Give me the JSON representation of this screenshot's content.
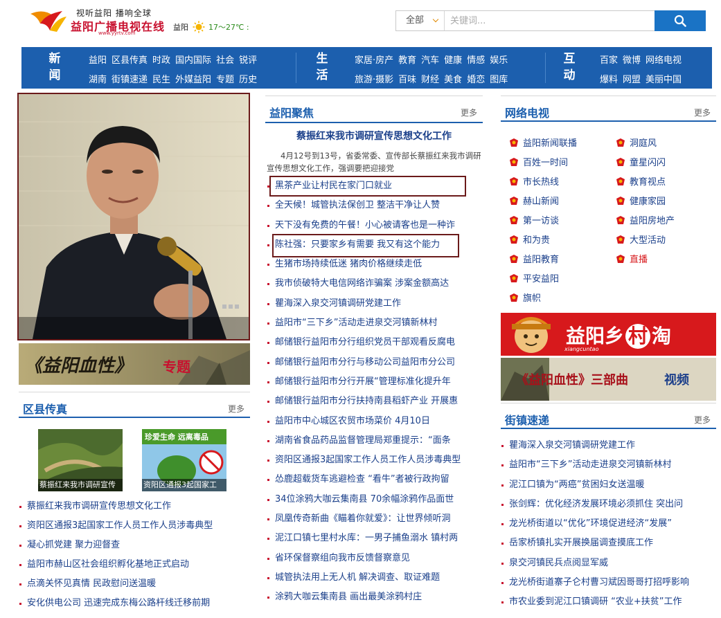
{
  "header": {
    "slogan": "视听益阳 播响全球",
    "site_name": "益阳广播电视在线",
    "site_url": "www.yyrtv.com",
    "weather_city": "益阳",
    "weather_temp": "17～27℃ :",
    "weather_icon": "sun-icon"
  },
  "search": {
    "scope": "全部",
    "placeholder": "关键词...",
    "button_icon": "magnifier-icon"
  },
  "nav": {
    "news": {
      "heading": [
        "新",
        "闻"
      ],
      "row1": [
        "益阳",
        "区县传真",
        "时政",
        "国内国际",
        "社会",
        "锐评"
      ],
      "row2": [
        "湖南",
        "街镇速递",
        "民生",
        "外媒益阳",
        "专题",
        "历史"
      ]
    },
    "life": {
      "heading": [
        "生",
        "活"
      ],
      "row1": [
        "家居·房产",
        "教育",
        "汽车",
        "健康",
        "情感",
        "娱乐"
      ],
      "row2": [
        "旅游·摄影",
        "百味",
        "财经",
        "美食",
        "婚恋",
        "图库"
      ]
    },
    "interact": {
      "heading": [
        "互",
        "动"
      ],
      "row1": [
        "百家",
        "微博",
        "网络电视"
      ],
      "row2": [
        "爆料",
        "网盟",
        "美丽中国"
      ]
    }
  },
  "left": {
    "banner_text": "《益阳血性》",
    "banner_tag": "专题",
    "county": {
      "title": "区县传真",
      "more": "更多",
      "thumbs": [
        {
          "caption": "蔡振红来我市调研宣传"
        },
        {
          "caption": "资阳区通报3起国家工",
          "overlay": "珍爱生命 远离毒品"
        }
      ],
      "items": [
        "蔡振红来我市调研宣传思想文化工作",
        "资阳区通报3起国家工作人员工作人员涉毒典型",
        "凝心抓党建 聚力迎督查",
        "益阳市赫山区社会组织孵化基地正式启动",
        "点滴关怀见真情 民政慰问送温暖",
        "安化供电公司 迅速完成东梅公路杆线迁移前期"
      ]
    }
  },
  "focus": {
    "title": "益阳聚焦",
    "more": "更多",
    "lead_title": "蔡振红来我市调研宣传思想文化工作",
    "lead_desc": "4月12号到13号，省委常委、宣传部长蔡振红来我市调研宣传思想文化工作，强调要把迎接党",
    "items": [
      "黑茶产业让村民在家门口就业",
      "全天候！城管执法保创卫 整洁干净让人赞",
      "天下没有免费的午餐！小心被请客也是一种诈",
      "陈社强：只要家乡有需要 我又有这个能力",
      "生猪市场持续低迷 猪肉价格继续走低",
      "我市侦破特大电信网络诈骗案 涉案金额高达",
      "瞿海深入泉交河镇调研党建工作",
      "益阳市“三下乡”活动走进泉交河镇新林村",
      "邮储银行益阳市分行组织党员干部观看反腐电",
      "邮储银行益阳市分行与移动公司益阳市分公司",
      "邮储银行益阳市分行开展“管理标准化提升年",
      "邮储银行益阳市分行扶持南县稻虾产业 开展惠",
      "益阳市中心城区农贸市场菜价 4月10日",
      "湖南省食品药品监督管理局郑重提示：“面条",
      "资阳区通报3起国家工作人员工作人员涉毒典型",
      "怂鹿超载货车逃避检查 “看牛”者被行政拘留",
      "34位涂鸦大咖云集南县 70余幅涂鸦作品面世",
      "凤凰传奇新曲《瞄着你就爱》：让世界倾听洞",
      "泥江口镇七里村水库：一男子捕鱼溺水 镇村两",
      "省环保督察组向我市反馈督察意见",
      "城管执法用上无人机 解决调查、取证难题",
      "涂鸦大咖云集南县 画出最美涂鸦村庄"
    ]
  },
  "tv": {
    "title": "网络电视",
    "more": "更多",
    "col1": [
      "益阳新闻联播",
      "百姓一时间",
      "市长热线",
      "赫山新闻",
      "第一访谈",
      "和为贵",
      "益阳教育",
      "平安益阳",
      "旗帜"
    ],
    "col2": [
      "洞庭风",
      "童星闪闪",
      "教育视点",
      "健康家园",
      "益阳房地产",
      "大型活动",
      "直播"
    ],
    "live_color": "#d7191c"
  },
  "banners": {
    "village_text": "益阳乡",
    "village_char": "村",
    "village_tail": "淘",
    "village_sub": "xiangcuntao",
    "trilogy_text": "《益阳血性》三部曲",
    "trilogy_tag": "视频"
  },
  "street": {
    "title": "街镇速递",
    "more": "更多",
    "items": [
      "瞿海深入泉交河镇调研党建工作",
      "益阳市“三下乡”活动走进泉交河镇新林村",
      "泥江口镇为“两癌”贫困妇女送温暖",
      "张剑辉：优化经济发展环境必须抓住 突出问",
      "龙光桥街道以“优化”环境促进经济“发展”",
      "岳家桥镇扎实开展换届调查摸底工作",
      "泉交河镇民兵点阅显军威",
      "龙光桥街道寨子仑村曹习斌因哥哥打招呼影响",
      "市农业委到泥江口镇调研 “农业+扶贫”工作"
    ]
  },
  "colors": {
    "nav_bg": "#1c5fae",
    "accent_red": "#c8102e",
    "link_blue": "#1a3f8a",
    "highlight_border": "#6b1a1a"
  }
}
